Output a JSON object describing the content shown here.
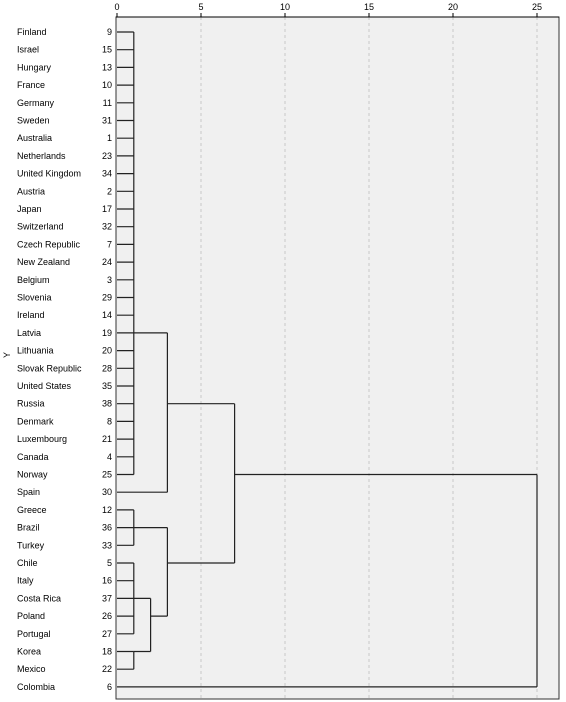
{
  "chart_data": {
    "type": "dendrogram",
    "title": "",
    "xlabel": "",
    "ylabel": "Y",
    "xlim": [
      0,
      25
    ],
    "xticks": [
      0,
      5,
      10,
      15,
      20,
      25
    ],
    "grid": true,
    "leaves": [
      {
        "label": "Finland",
        "id": "9"
      },
      {
        "label": "Israel",
        "id": "15"
      },
      {
        "label": "Hungary",
        "id": "13"
      },
      {
        "label": "France",
        "id": "10"
      },
      {
        "label": "Germany",
        "id": "11"
      },
      {
        "label": "Sweden",
        "id": "31"
      },
      {
        "label": "Australia",
        "id": "1"
      },
      {
        "label": "Netherlands",
        "id": "23"
      },
      {
        "label": "United Kingdom",
        "id": "34"
      },
      {
        "label": "Austria",
        "id": "2"
      },
      {
        "label": "Japan",
        "id": "17"
      },
      {
        "label": "Switzerland",
        "id": "32"
      },
      {
        "label": "Czech Republic",
        "id": "7"
      },
      {
        "label": "New Zealand",
        "id": "24"
      },
      {
        "label": "Belgium",
        "id": "3"
      },
      {
        "label": "Slovenia",
        "id": "29"
      },
      {
        "label": "Ireland",
        "id": "14"
      },
      {
        "label": "Latvia",
        "id": "19"
      },
      {
        "label": "Lithuania",
        "id": "20"
      },
      {
        "label": "Slovak Republic",
        "id": "28"
      },
      {
        "label": "United States",
        "id": "35"
      },
      {
        "label": "Russia",
        "id": "38"
      },
      {
        "label": "Denmark",
        "id": "8"
      },
      {
        "label": "Luxembourg",
        "id": "21"
      },
      {
        "label": "Canada",
        "id": "4"
      },
      {
        "label": "Norway",
        "id": "25"
      },
      {
        "label": "Spain",
        "id": "30"
      },
      {
        "label": "Greece",
        "id": "12"
      },
      {
        "label": "Brazil",
        "id": "36"
      },
      {
        "label": "Turkey",
        "id": "33"
      },
      {
        "label": "Chile",
        "id": "5"
      },
      {
        "label": "Italy",
        "id": "16"
      },
      {
        "label": "Costa Rica",
        "id": "37"
      },
      {
        "label": "Poland",
        "id": "26"
      },
      {
        "label": "Portugal",
        "id": "27"
      },
      {
        "label": "Korea",
        "id": "18"
      },
      {
        "label": "Mexico",
        "id": "22"
      },
      {
        "label": "Colombia",
        "id": "6"
      }
    ],
    "tree": {
      "height": 25,
      "children": [
        {
          "height": 7,
          "children": [
            {
              "height": 3,
              "children": [
                {
                  "height": 1,
                  "children": [
                    0,
                    1,
                    2,
                    3,
                    4,
                    5,
                    6,
                    7,
                    8,
                    9,
                    10,
                    11,
                    12,
                    13,
                    14,
                    15,
                    16,
                    17,
                    18,
                    19,
                    20,
                    21,
                    22,
                    23,
                    24,
                    25
                  ]
                },
                26
              ]
            },
            {
              "height": 3,
              "children": [
                {
                  "height": 1,
                  "children": [
                    27,
                    28,
                    29
                  ]
                },
                {
                  "height": 2,
                  "children": [
                    {
                      "height": 1,
                      "children": [
                        30,
                        31,
                        32,
                        33,
                        34
                      ]
                    },
                    {
                      "height": 1,
                      "children": [
                        35,
                        36
                      ]
                    }
                  ]
                }
              ]
            }
          ]
        },
        37
      ]
    }
  }
}
